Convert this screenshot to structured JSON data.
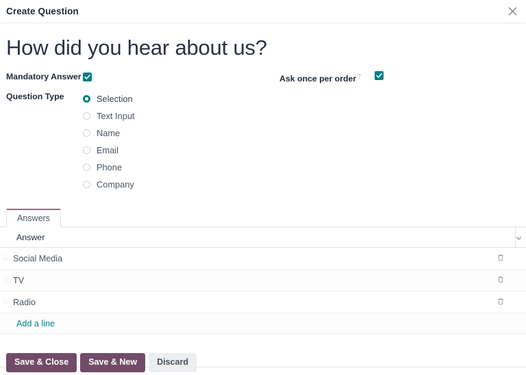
{
  "dialog": {
    "title": "Create Question",
    "close_icon": "close-icon"
  },
  "record": {
    "title": "How did you hear about us?"
  },
  "fields": {
    "mandatory_answer": {
      "label": "Mandatory Answer",
      "checked_icon": "check-icon",
      "value": "true"
    },
    "ask_once_per_order": {
      "label": "Ask once per order",
      "help_icon": "?",
      "checked_icon": "check-icon",
      "value": "true"
    },
    "question_type": {
      "label": "Question Type",
      "selected": "Selection",
      "options": [
        {
          "label": "Selection",
          "checked": true
        },
        {
          "label": "Text Input",
          "checked": false
        },
        {
          "label": "Name",
          "checked": false
        },
        {
          "label": "Email",
          "checked": false
        },
        {
          "label": "Phone",
          "checked": false
        },
        {
          "label": "Company",
          "checked": false
        }
      ]
    }
  },
  "notebook": {
    "tabs": [
      {
        "label": "Answers",
        "active": true
      }
    ]
  },
  "list": {
    "columns": [
      {
        "label": "Answer"
      }
    ],
    "optional_columns_icon": "chevron-down-icon",
    "row_delete_icon": "trash-icon",
    "row_drag_icon": "drag-handle-icon",
    "rows": [
      {
        "answer": "Social Media"
      },
      {
        "answer": "TV"
      },
      {
        "answer": "Radio"
      }
    ],
    "add_line_label": "Add a line"
  },
  "footer": {
    "save_close_label": "Save & Close",
    "save_new_label": "Save & New",
    "discard_label": "Discard"
  },
  "colors": {
    "brand_purple": "#714b67",
    "accent_teal": "#017e84",
    "link_teal": "#00848c",
    "tab_accent": "#8f6f85"
  }
}
